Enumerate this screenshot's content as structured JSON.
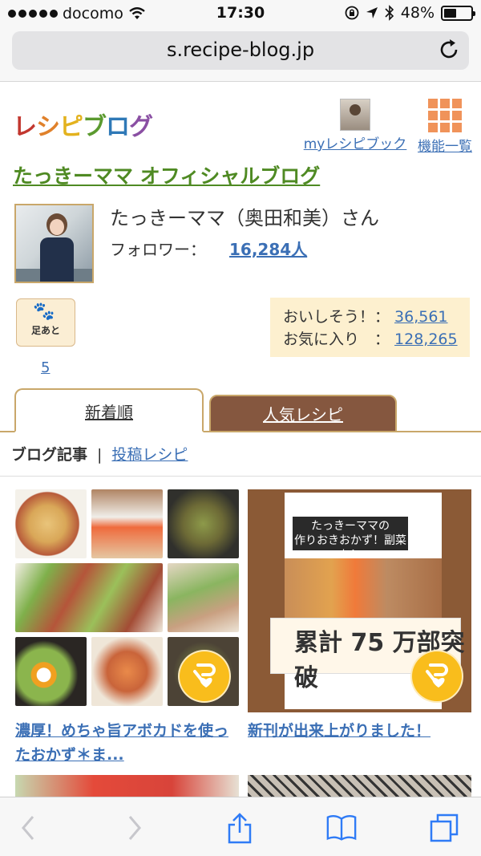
{
  "status_bar": {
    "carrier": "docomo",
    "time": "17:30",
    "battery": "48%",
    "battery_level": 0.48
  },
  "browser": {
    "url": "s.recipe-blog.jp"
  },
  "header": {
    "logo_text": "レシピブログ",
    "logo_colors": [
      "#c2372f",
      "#e0812b",
      "#e3b21e",
      "#5b9a2f",
      "#2f79b7",
      "#8a4fa3"
    ],
    "my_recipe_book": "myレシピブック",
    "menu": "機能一覧"
  },
  "blog": {
    "title": "たっきーママ オフィシャルブログ",
    "author_name": "たっきーママ（奥田和美）さん",
    "follower_label": "フォロワー：",
    "follower_count": "16,284人"
  },
  "footprint": {
    "label": "足あと",
    "count": "5"
  },
  "stats": {
    "oishisou_label": "おいしそう！：",
    "oishisou_value": "36,561",
    "favorite_label": "お気に入り　：",
    "favorite_value": "128,265"
  },
  "tabs": [
    {
      "label": "新着順",
      "active": true
    },
    {
      "label": "人気レシピ",
      "active": false
    }
  ],
  "subnav": {
    "current": "ブログ記事",
    "separator": "|",
    "link": "投稿レシピ"
  },
  "articles": [
    {
      "title": "濃厚！めちゃ旨アボカドを使ったおかず＊ま..."
    },
    {
      "title": "新刊が出来上がりました！",
      "book_band": "たっきーママの\n作りおきおかず！副菜も！\n全部レンジで朝すぐ！弁当",
      "book_sales": "累計 75 万部突破"
    }
  ],
  "accent": {
    "brand_green": "#4f8a23",
    "link_blue": "#3b6fb5",
    "tab_brown": "#85573f",
    "badge_yellow": "#f9bd1c"
  }
}
